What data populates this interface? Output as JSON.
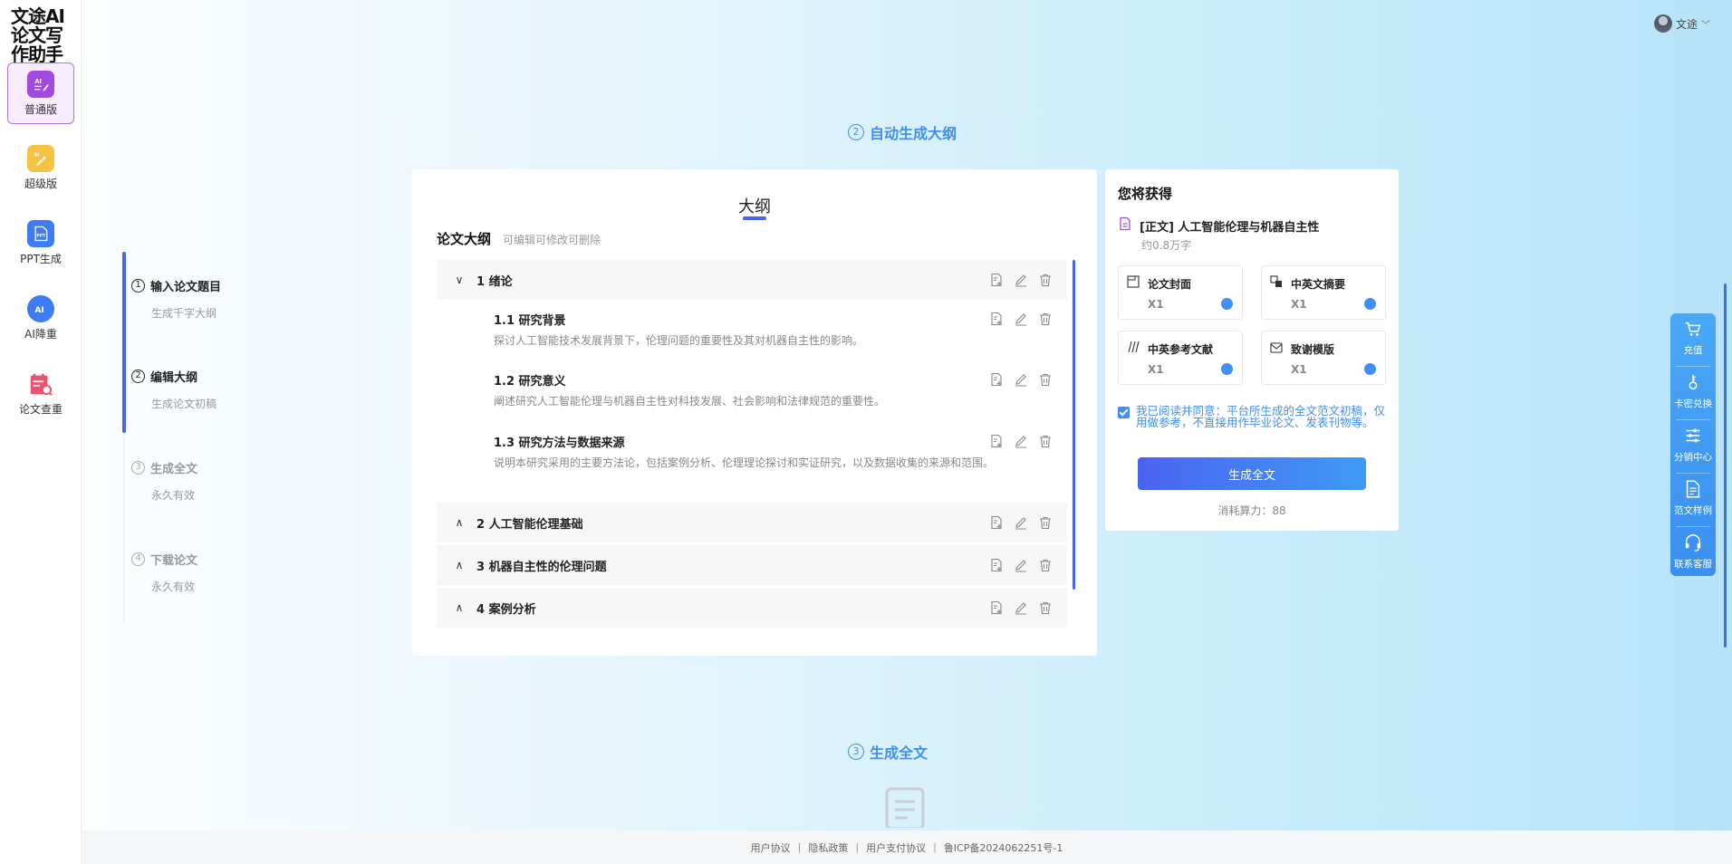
{
  "app": {
    "logo_text": "文途AI论文写作助手"
  },
  "nav": [
    {
      "label": "普通版",
      "icon": "ai-writing-icon",
      "color": "#a24ae0"
    },
    {
      "label": "超级版",
      "icon": "super-edit-icon",
      "color": "#f5c242"
    },
    {
      "label": "PPT生成",
      "icon": "ppt-file-icon",
      "color": "#3f7bf5"
    },
    {
      "label": "AI降重",
      "icon": "ai-reduce-icon",
      "color": "#3f7bf5"
    },
    {
      "label": "论文查重",
      "icon": "plagiarism-check-icon",
      "color": "#f0506e"
    }
  ],
  "steps": [
    {
      "num": "1",
      "title": "输入论文题目",
      "subtitle": "生成千字大纲"
    },
    {
      "num": "2",
      "title": "编辑大纲",
      "subtitle": "生成论文初稿"
    },
    {
      "num": "3",
      "title": "生成全文",
      "subtitle": "永久有效"
    },
    {
      "num": "4",
      "title": "下载论文",
      "subtitle": "永久有效"
    }
  ],
  "section2": {
    "num": "2",
    "title": "自动生成大纲"
  },
  "section3": {
    "num": "3",
    "title": "生成全文"
  },
  "outline": {
    "tab": "大纲",
    "title": "论文大纲",
    "hint": "可编辑可修改可删除",
    "chapters": [
      {
        "label": "1 绪论",
        "expanded": true
      },
      {
        "label": "2 人工智能伦理基础",
        "expanded": false
      },
      {
        "label": "3 机器自主性的伦理问题",
        "expanded": false
      },
      {
        "label": "4 案例分析",
        "expanded": false
      }
    ],
    "subsections": [
      {
        "title": "1.1 研究背景",
        "desc": "探讨人工智能技术发展背景下，伦理问题的重要性及其对机器自主性的影响。"
      },
      {
        "title": "1.2 研究意义",
        "desc": "阐述研究人工智能伦理与机器自主性对科技发展、社会影响和法律规范的重要性。"
      },
      {
        "title": "1.3 研究方法与数据来源",
        "desc": "说明本研究采用的主要方法论，包括案例分析、伦理理论探讨和实证研究，以及数据收集的来源和范围。"
      }
    ]
  },
  "get_card": {
    "title": "您将获得",
    "doc_name": "[正文] 人工智能伦理与机器自主性",
    "words": "约0.8万字",
    "items": [
      {
        "name": "论文封面",
        "qty": "X1",
        "icon": "cover-icon"
      },
      {
        "name": "中英文摘要",
        "qty": "X1",
        "icon": "abstract-icon"
      },
      {
        "name": "中英参考文献",
        "qty": "X1",
        "icon": "reference-icon"
      },
      {
        "name": "致谢模版",
        "qty": "X1",
        "icon": "thanks-icon"
      }
    ],
    "agree_text": "我已阅读并同意：平台所生成的全文范文初稿，仅用做参考，不直接用作毕业论文、发表刊物等。",
    "button": "生成全文",
    "cost": "消耗算力：88"
  },
  "float_bar": [
    {
      "label": "充值",
      "icon": "cart-icon"
    },
    {
      "label": "卡密兑换",
      "icon": "key-icon"
    },
    {
      "label": "分销中心",
      "icon": "sliders-icon"
    },
    {
      "label": "范文样例",
      "icon": "document-icon"
    },
    {
      "label": "联系客服",
      "icon": "headset-icon"
    }
  ],
  "user": {
    "name": "文途"
  },
  "footer": {
    "links": [
      "用户协议",
      "隐私政策",
      "用户支付协议"
    ],
    "icp": "鲁ICP备2024062251号-1"
  },
  "colors": {
    "accent": "#4a63f2",
    "heading_blue": "#3f8ff5",
    "active_purple": "#b46fe0"
  }
}
